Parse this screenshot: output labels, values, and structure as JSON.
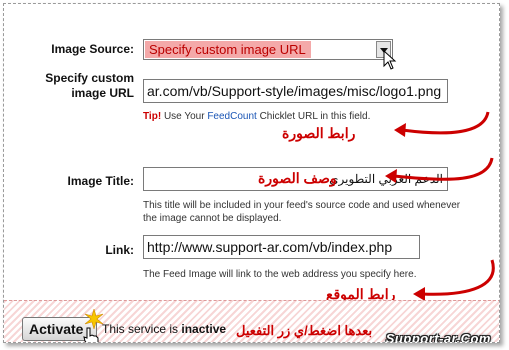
{
  "form": {
    "image_source_label": "Image Source:",
    "image_source_value": "Specify custom image URL",
    "custom_url_label_1": "Specify custom",
    "custom_url_label_2": "image URL",
    "custom_url_value": "ar.com/vb/Support-style/images/misc/logo1.png",
    "tip_label": "Tip!",
    "tip_text_1": "Use Your",
    "tip_link": "FeedCount",
    "tip_text_2": "Chicklet URL in this field.",
    "image_title_label": "Image Title:",
    "image_title_value": "الدعم العربي التطويري",
    "title_help_1": "This title will be included in your feed's source code and used whenever",
    "title_help_2": "the image cannot be displayed.",
    "link_label": "Link:",
    "link_value": "http://www.support-ar.com/vb/index.php",
    "link_help": "The Feed Image will link to the web address you specify here."
  },
  "annotations": {
    "image_url": "رابط الصورة",
    "image_desc": "وصف الصورة",
    "site_link": "رابط الموقع",
    "activate_hint": "بعدها اضغط/ي زر التفعيل"
  },
  "footer": {
    "activate_button": "Activate",
    "status_prefix": "This service is",
    "status_value": "inactive",
    "watermark": "Support-ar.Com"
  },
  "colors": {
    "annotation": "#cc0000",
    "select_highlight": "#f4a9a9",
    "link": "#1a55b5"
  }
}
